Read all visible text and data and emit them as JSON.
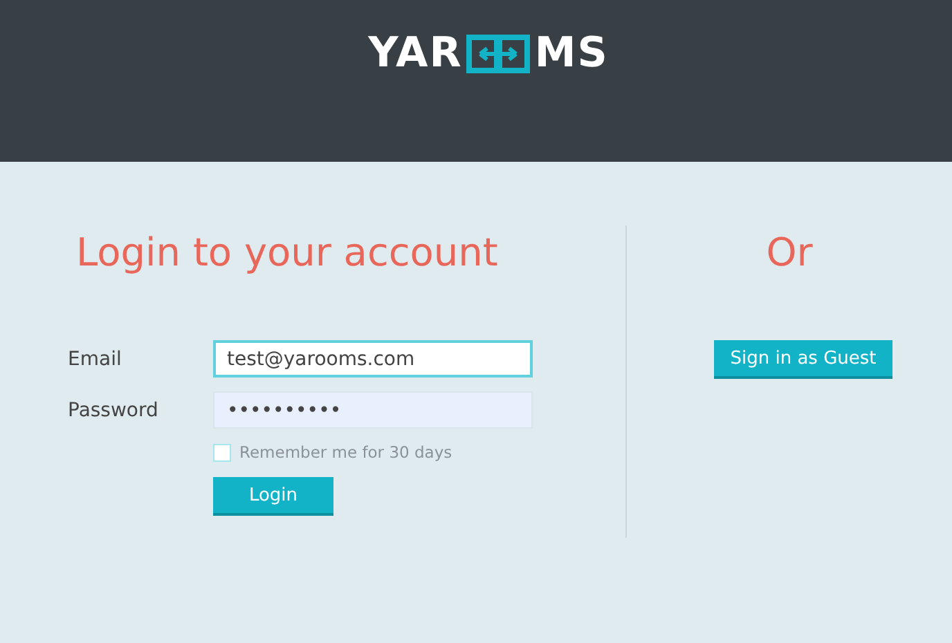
{
  "header": {
    "logo": {
      "left": "YAR",
      "right": "MS"
    }
  },
  "login": {
    "title": "Login to your account",
    "fields": [
      {
        "label": "Email",
        "value": "test@yarooms.com",
        "focused": true
      },
      {
        "label": "Password",
        "value": "••••••••••",
        "focused": false
      }
    ],
    "remember": {
      "label": "Remember me for 30 days",
      "checked": false
    },
    "button": "Login"
  },
  "alternative": {
    "title": "Or",
    "button": "Sign in as Guest"
  }
}
